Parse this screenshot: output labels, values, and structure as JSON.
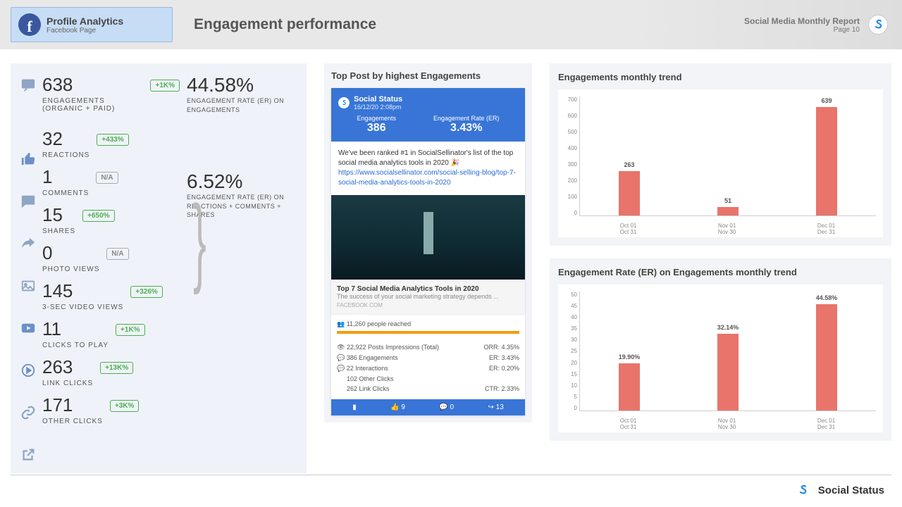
{
  "header": {
    "profile_title": "Profile Analytics",
    "profile_sub": "Facebook Page",
    "page_title": "Engagement performance",
    "report_name": "Social Media Monthly Report",
    "page_num": "Page 10"
  },
  "metrics": {
    "engagements": {
      "v": "638",
      "b": "+1K%",
      "l": "ENGAGEMENTS (ORGANIC + PAID)"
    },
    "reactions": {
      "v": "32",
      "b": "+433%",
      "l": "REACTIONS"
    },
    "comments": {
      "v": "1",
      "b": "N/A",
      "l": "COMMENTS"
    },
    "shares": {
      "v": "15",
      "b": "+650%",
      "l": "SHARES"
    },
    "photo": {
      "v": "0",
      "b": "N/A",
      "l": "PHOTO VIEWS"
    },
    "video": {
      "v": "145",
      "b": "+326%",
      "l": "3-SEC VIDEO VIEWS"
    },
    "play": {
      "v": "11",
      "b": "+1K%",
      "l": "CLICKS TO PLAY"
    },
    "link": {
      "v": "263",
      "b": "+13K%",
      "l": "LINK CLICKS"
    },
    "other": {
      "v": "171",
      "b": "+3K%",
      "l": "OTHER CLICKS"
    }
  },
  "er": {
    "eng": {
      "v": "44.58%",
      "l": "ENGAGEMENT RATE (ER) ON ENGAGEMENTS"
    },
    "rcs": {
      "v": "6.52%",
      "l": "ENGAGEMENT RATE (ER) ON REACTIONS + COMMENTS + SHARES"
    }
  },
  "top_post": {
    "title": "Top Post by highest Engagements",
    "brand": "Social Status",
    "date": "16/12/20 2:08pm",
    "eng_l": "Engagements",
    "eng_v": "386",
    "err_l": "Engagement Rate (ER)",
    "err_v": "3.43%",
    "body": "We've been ranked #1 in SocialSellinator's list of the top social media analytics tools in 2020 🎉",
    "link": "https://www.socialsellinator.com/social-selling-blog/top-7-social-media-analytics-tools-in-2020",
    "cap_t": "Top 7 Social Media Analytics Tools in 2020",
    "cap_s": "The success of your social marketing strategy depends ...",
    "cap_d": "FACEBOOK.COM",
    "reach": "11,260 people reached",
    "d1l": "22,922 Posts Impressions (Total)",
    "d1r": "ORR: 4.35%",
    "d2l": "386 Engagements",
    "d2r": "ER: 3.43%",
    "d3l": "22 Interactions",
    "d3r": "ER: 0.20%",
    "d4l": "102 Other Clicks",
    "d4r": "",
    "d5l": "262 Link Clicks",
    "d5r": "CTR: 2.33%",
    "foot_like": "9",
    "foot_cmt": "0",
    "foot_shr": "13"
  },
  "chart_data": [
    {
      "type": "bar",
      "title": "Engagements monthly trend",
      "categories": [
        "Oct 01\nOct 31",
        "Nov 01\nNov 30",
        "Dec 01\nDec 31"
      ],
      "values": [
        263,
        51,
        639
      ],
      "ylim": [
        0,
        700
      ],
      "yticks": [
        0,
        100,
        200,
        300,
        400,
        500,
        600,
        700
      ]
    },
    {
      "type": "bar",
      "title": "Engagement Rate (ER) on Engagements monthly trend",
      "categories": [
        "Oct 01\nOct 31",
        "Nov 01\nNov 30",
        "Dec 01\nDec 31"
      ],
      "values": [
        19.9,
        32.14,
        44.58
      ],
      "value_labels": [
        "19.90%",
        "32.14%",
        "44.58%"
      ],
      "ylim": [
        0,
        50
      ],
      "yticks": [
        0,
        5,
        10,
        15,
        20,
        25,
        30,
        35,
        40,
        45,
        50
      ]
    }
  ],
  "footer": {
    "brand": "Social Status"
  }
}
